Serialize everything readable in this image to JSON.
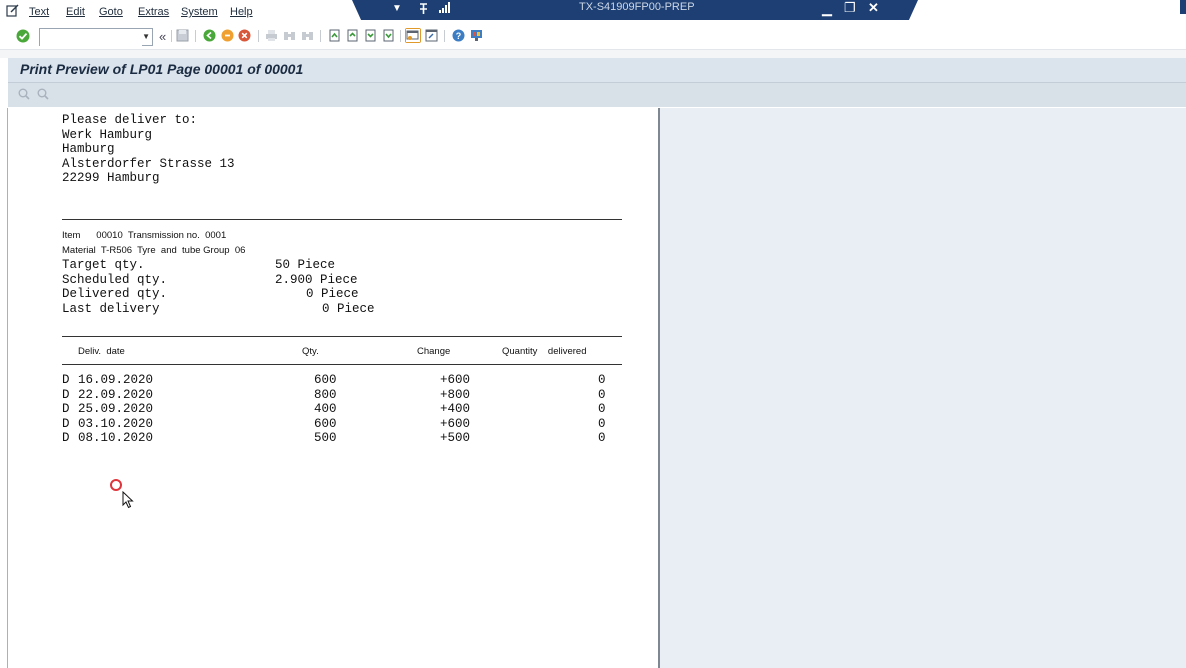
{
  "menu": {
    "items": [
      "Text",
      "Edit",
      "Goto",
      "Extras",
      "System",
      "Help"
    ],
    "system_id": "TX-S41909FP00-PREP"
  },
  "toolbar": {
    "command_field_value": "",
    "back_glyph": "«"
  },
  "title": "Print Preview of LP01 Page 00001 of 00001",
  "address": {
    "heading": "Please deliver to:",
    "lines": [
      "Werk Hamburg",
      "Hamburg",
      "Alsterdorfer Strasse 13",
      "22299 Hamburg"
    ]
  },
  "item": {
    "item_line": "Item      00010  Transmission no.  0001",
    "material_line": "Material  T-R506  Tyre  and  tube Group  06",
    "quantities": [
      {
        "label": "Target qty.",
        "value": "50 Piece"
      },
      {
        "label": "Scheduled qty.",
        "value": "2.900 Piece"
      },
      {
        "label": "Delivered qty.",
        "value": "0 Piece"
      },
      {
        "label": "Last delivery",
        "value": "0 Piece"
      }
    ]
  },
  "schedule": {
    "headers": {
      "date": "Deliv.  date",
      "qty": "Qty.",
      "change": "Change",
      "delivered": "Quantity    delivered"
    },
    "rows": [
      {
        "prefix": "D",
        "date": "16.09.2020",
        "qty": "600",
        "change": "+600",
        "delivered": "0"
      },
      {
        "prefix": "D",
        "date": "22.09.2020",
        "qty": "800",
        "change": "+800",
        "delivered": "0"
      },
      {
        "prefix": "D",
        "date": "25.09.2020",
        "qty": "400",
        "change": "+400",
        "delivered": "0"
      },
      {
        "prefix": "D",
        "date": "03.10.2020",
        "qty": "600",
        "change": "+600",
        "delivered": "0"
      },
      {
        "prefix": "D",
        "date": "08.10.2020",
        "qty": "500",
        "change": "+500",
        "delivered": "0"
      }
    ]
  },
  "colors": {
    "title_bar": "#1d3f73",
    "title_area": "#dbe4ec",
    "work_area": "#e8eef4",
    "cursor_ring": "#e0343c"
  }
}
